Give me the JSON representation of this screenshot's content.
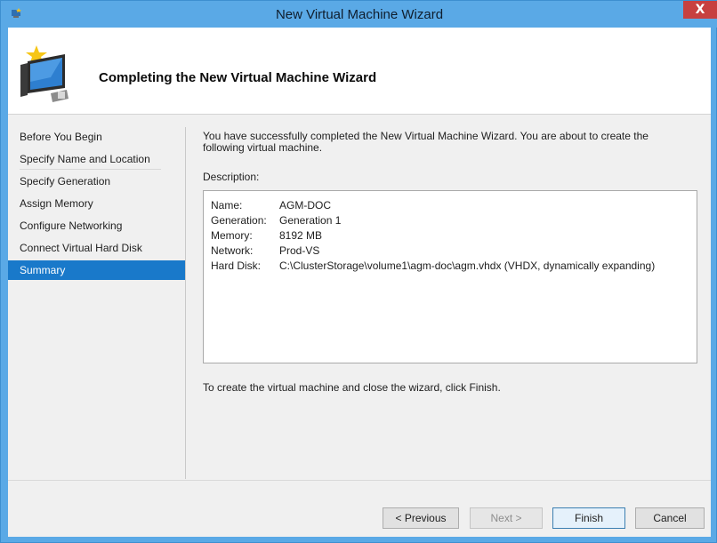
{
  "window": {
    "title": "New Virtual Machine Wizard",
    "close_label": "X"
  },
  "header": {
    "title": "Completing the New Virtual Machine Wizard",
    "icon": "vm-wizard-monitor-icon"
  },
  "nav": {
    "items": [
      {
        "label": "Before You Begin",
        "selected": false
      },
      {
        "label": "Specify Name and Location",
        "selected": false
      },
      {
        "label": "Specify Generation",
        "selected": false
      },
      {
        "label": "Assign Memory",
        "selected": false
      },
      {
        "label": "Configure Networking",
        "selected": false
      },
      {
        "label": "Connect Virtual Hard Disk",
        "selected": false
      },
      {
        "label": "Summary",
        "selected": true
      }
    ]
  },
  "content": {
    "intro": "You have successfully completed the New Virtual Machine Wizard. You are about to create the following virtual machine.",
    "description_label": "Description:",
    "summary": [
      {
        "key": "Name:",
        "value": "AGM-DOC"
      },
      {
        "key": "Generation:",
        "value": "Generation 1"
      },
      {
        "key": "Memory:",
        "value": "8192 MB"
      },
      {
        "key": "Network:",
        "value": "Prod-VS"
      },
      {
        "key": "Hard Disk:",
        "value": "C:\\ClusterStorage\\volume1\\agm-doc\\agm.vhdx (VHDX, dynamically expanding)"
      }
    ],
    "finish_note": "To create the virtual machine and close the wizard, click Finish."
  },
  "buttons": {
    "previous": "< Previous",
    "next": "Next >",
    "finish": "Finish",
    "cancel": "Cancel"
  },
  "colors": {
    "titlebar": "#5aa9e6",
    "selection": "#1979ca",
    "close": "#c74040"
  }
}
